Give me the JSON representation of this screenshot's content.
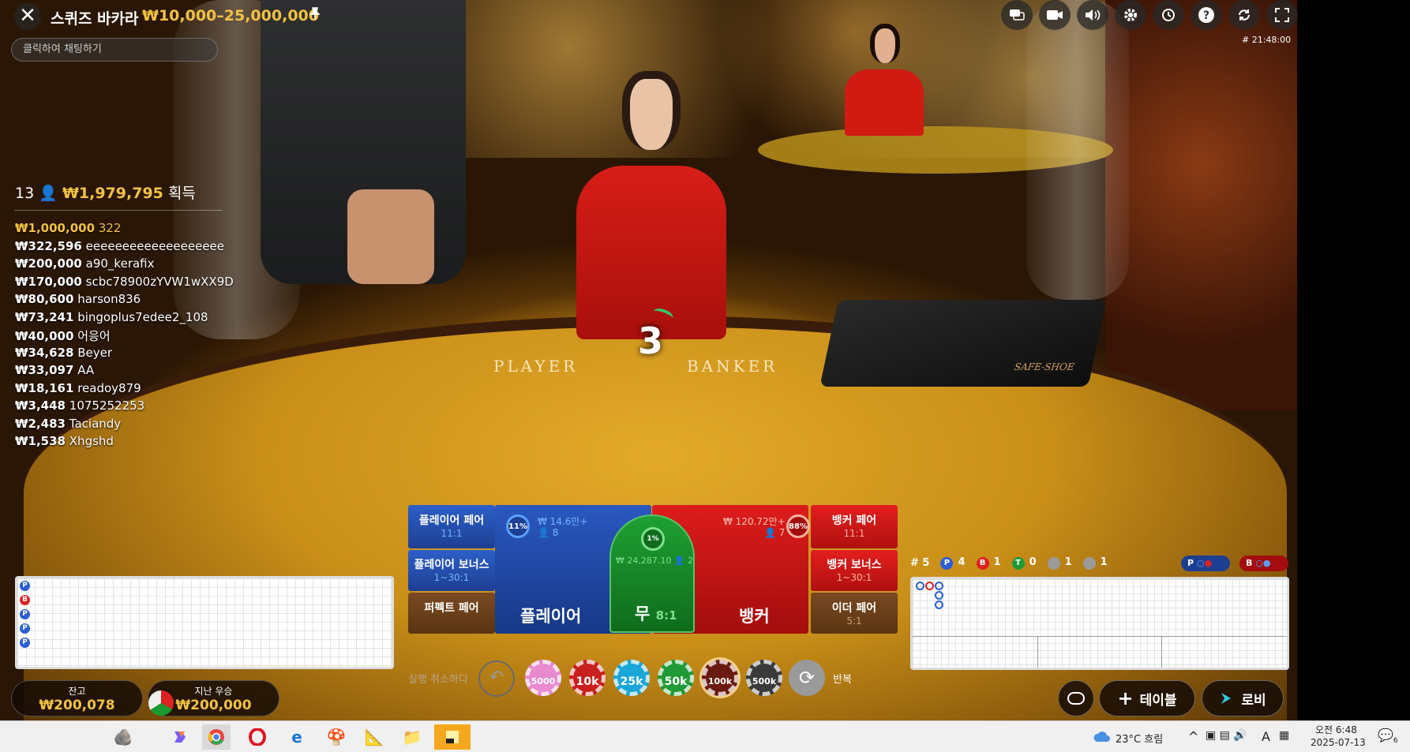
{
  "header": {
    "close": "✕",
    "title": "스퀴즈 바카라",
    "limit": "₩10,000–25,000,000",
    "pin": "📌",
    "chat_placeholder": "클릭하여 채팅하기",
    "game_id": "# 21:48:00",
    "icons": [
      "chat-icon",
      "video-icon",
      "volume-icon",
      "settings-icon",
      "history-icon",
      "help-icon",
      "sync-icon",
      "fullscreen-icon"
    ]
  },
  "table": {
    "player_text": "PLAYER",
    "banker_text": "BANKER",
    "countdown": "3",
    "shoe_brand": "SAFE-SHOE"
  },
  "winners": {
    "count": "13",
    "total": "₩1,979,795",
    "suffix": "획득",
    "rows": [
      {
        "amount": "₩1,000,000",
        "name": "322"
      },
      {
        "amount": "₩322,596",
        "name": "eeeeeeeeeeeeeeeeeee"
      },
      {
        "amount": "₩200,000",
        "name": "a90_kerafix"
      },
      {
        "amount": "₩170,000",
        "name": "scbc78900zYVW1wXX9D"
      },
      {
        "amount": "₩80,600",
        "name": "harson836"
      },
      {
        "amount": "₩73,241",
        "name": "bingoplus7edee2_108"
      },
      {
        "amount": "₩40,000",
        "name": "어응어"
      },
      {
        "amount": "₩34,628",
        "name": "Beyer"
      },
      {
        "amount": "₩33,097",
        "name": "AA"
      },
      {
        "amount": "₩18,161",
        "name": "readoy879"
      },
      {
        "amount": "₩3,448",
        "name": "1075252253"
      },
      {
        "amount": "₩2,483",
        "name": "Taciandy"
      },
      {
        "amount": "₩1,538",
        "name": "Xhgshd"
      }
    ]
  },
  "bets": {
    "player_pair": {
      "label": "플레이어 페어",
      "odds": "11:1"
    },
    "player_bonus": {
      "label": "플레이어 보너스",
      "odds": "1~30:1"
    },
    "perfect_pair": {
      "label": "퍼펙트 페어",
      "odds": ""
    },
    "banker_pair": {
      "label": "뱅커 페어",
      "odds": "11:1"
    },
    "banker_bonus": {
      "label": "뱅커 보너스",
      "odds": "1~30:1"
    },
    "either_pair": {
      "label": "이더 페어",
      "odds": "5:1"
    },
    "player": {
      "label": "플레이어",
      "pct": "11%",
      "pool": "₩ 14.6만+",
      "players": "8"
    },
    "tie": {
      "label": "무",
      "odds": "8:1",
      "pct": "1%",
      "pool": "₩ 24,287.10",
      "players": "2"
    },
    "banker": {
      "label": "뱅커",
      "pct": "88%",
      "pool": "₩ 120.72만+",
      "players": "7"
    }
  },
  "road_stats": {
    "round": "# 5",
    "player": "4",
    "banker": "1",
    "tie": "0",
    "player_pair": "1",
    "banker_pair": "1",
    "p_predict": "P",
    "b_predict": "B"
  },
  "bead_road": [
    "P",
    "B",
    "P",
    "P",
    "P"
  ],
  "chips": {
    "undo_label": "실행 취소하다",
    "values": [
      "5000",
      "10k",
      "25k",
      "50k",
      "100k",
      "500k"
    ],
    "colors": [
      "#e88ad0",
      "#c8201e",
      "#1aa6d6",
      "#1f9a36",
      "#6a1a10",
      "#3a3a3a"
    ],
    "selected_index": 4,
    "repeat_label": "반복"
  },
  "balance": {
    "label": "잔고",
    "value": "₩200,078"
  },
  "last_win": {
    "label": "지난 우승",
    "value": "₩200,000"
  },
  "bottom_buttons": {
    "table": "테이블",
    "lobby": "로비"
  },
  "taskbar": {
    "weather": "23°C 흐림",
    "ime": "A",
    "time": "오전 6:48",
    "date": "2025-07-13",
    "notify_count": "6"
  }
}
